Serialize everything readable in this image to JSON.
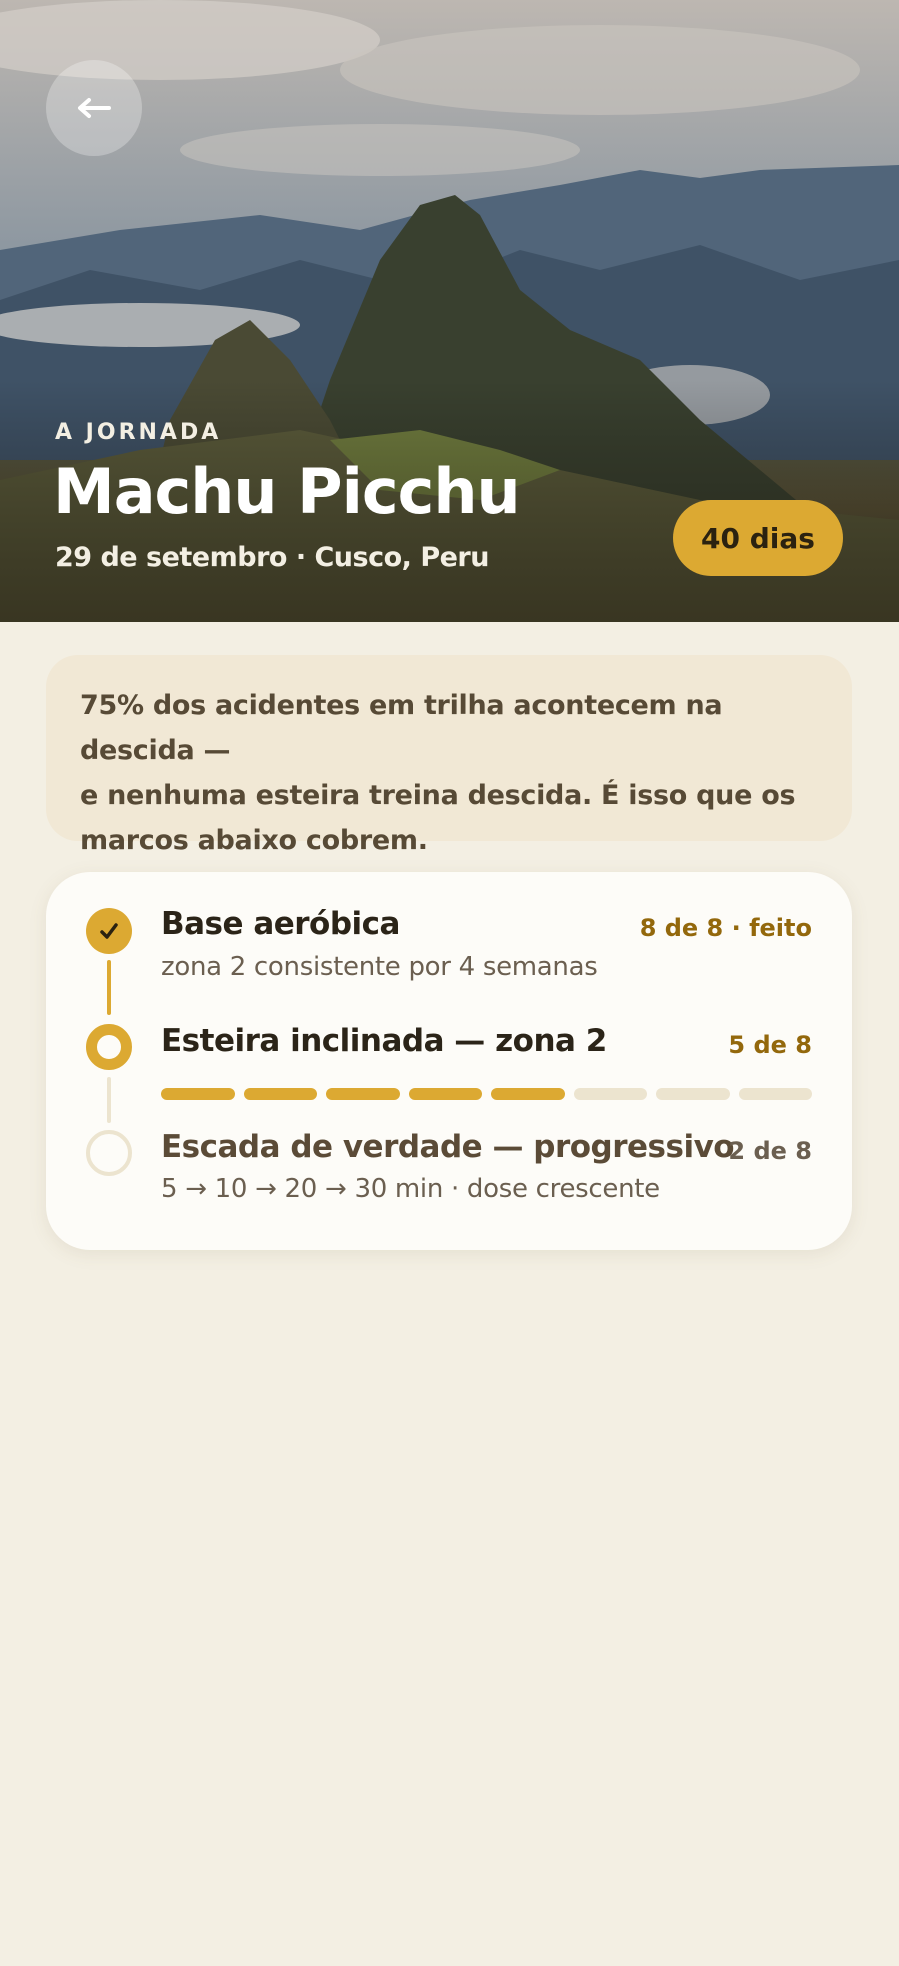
{
  "hero": {
    "eyebrow": "A JORNADA",
    "title": "Machu Picchu",
    "subtitle": "29 de setembro · Cusco, Peru",
    "days_badge": "40 dias",
    "back_icon": "arrow-left-icon"
  },
  "callout": {
    "line1": "75% dos acidentes em trilha acontecem na descida —",
    "line2": "e nenhuma esteira treina descida. É isso que os",
    "line3": "marcos abaixo cobrem."
  },
  "milestones": [
    {
      "title": "Base aeróbica",
      "subtitle": "zona 2 consistente por 4 semanas",
      "status": "8 de 8 · feito",
      "state": "done",
      "icon": "check-icon"
    },
    {
      "title": "Esteira inclinada — zona 2",
      "status": "5 de 8",
      "state": "current",
      "progress": {
        "done": 5,
        "total": 8
      }
    },
    {
      "title": "Escada de verdade — progressivo",
      "subtitle": "5 → 10 → 20 → 30 min · dose crescente",
      "status": "2 de 8",
      "state": "upcoming"
    }
  ],
  "colors": {
    "accent": "#dca932",
    "accent_text": "#93680c",
    "background": "#f3efe3",
    "callout_bg": "#f1e8d5",
    "card_bg": "#fdfcf8",
    "track_inactive": "#ece4cf"
  }
}
